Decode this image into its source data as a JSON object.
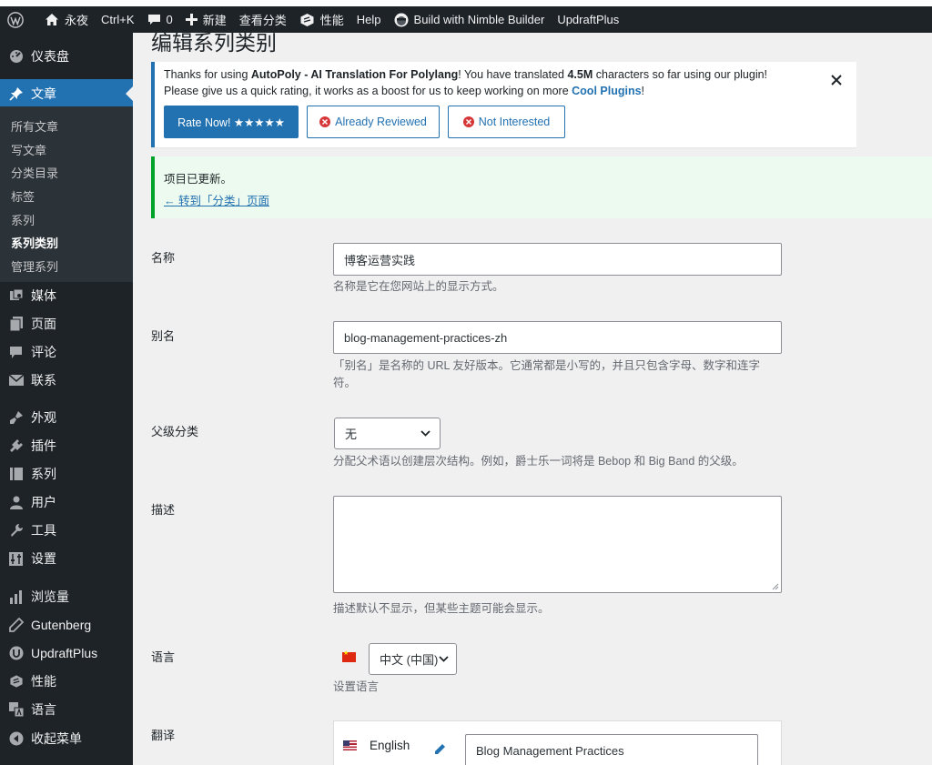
{
  "adminbar": {
    "site_name": "永夜",
    "shortcut": "Ctrl+K",
    "comments_count": "0",
    "new_label": "新建",
    "view_category": "查看分类",
    "performance": "性能",
    "help": "Help",
    "nimble": "Build with Nimble Builder",
    "updraft": "UpdraftPlus"
  },
  "menu": {
    "dashboard": "仪表盘",
    "posts": "文章",
    "submenu": [
      "所有文章",
      "写文章",
      "分类目录",
      "标签",
      "系列",
      "系列类别",
      "管理系列"
    ],
    "media": "媒体",
    "pages": "页面",
    "comments": "评论",
    "contact": "联系",
    "appearance": "外观",
    "plugins": "插件",
    "series": "系列",
    "users": "用户",
    "tools": "工具",
    "settings": "设置",
    "stats": "浏览量",
    "gutenberg": "Gutenberg",
    "updraftplus": "UpdraftPlus",
    "performance": "性能",
    "language": "语言",
    "collapse": "收起菜单"
  },
  "page": {
    "title": "编辑系列类别"
  },
  "promo": {
    "l1_a": "Thanks for using ",
    "l1_b": "AutoPoly - AI Translation For Polylang",
    "l1_c": "! You have translated ",
    "l1_d": "4.5M",
    "l1_e": " characters so far using our plugin!",
    "l2_a": "Please give us a quick rating, it works as a boost for us to keep working on more ",
    "l2_b": "Cool Plugins",
    "l2_c": "!",
    "rate": "Rate Now! ★★★★★",
    "reviewed": "Already Reviewed",
    "not_interested": "Not Interested"
  },
  "success": {
    "message": "项目已更新。",
    "back_link": "← 转到「分类」页面"
  },
  "form": {
    "name_label": "名称",
    "name_value": "博客运营实践",
    "name_desc": "名称是它在您网站上的显示方式。",
    "slug_label": "别名",
    "slug_value": "blog-management-practices-zh",
    "slug_desc": "「别名」是名称的 URL 友好版本。它通常都是小写的，并且只包含字母、数字和连字符。",
    "parent_label": "父级分类",
    "parent_value": "无",
    "parent_desc": "分配父术语以创建层次结构。例如，爵士乐一词将是 Bebop 和 Big Band 的父级。",
    "description_label": "描述",
    "description_desc": "描述默认不显示，但某些主题可能会显示。",
    "language_label": "语言",
    "language_value": "中文 (中国)",
    "language_desc": "设置语言",
    "translation_label": "翻译",
    "translation_lang": "English",
    "translation_value": "Blog Management Practices"
  }
}
